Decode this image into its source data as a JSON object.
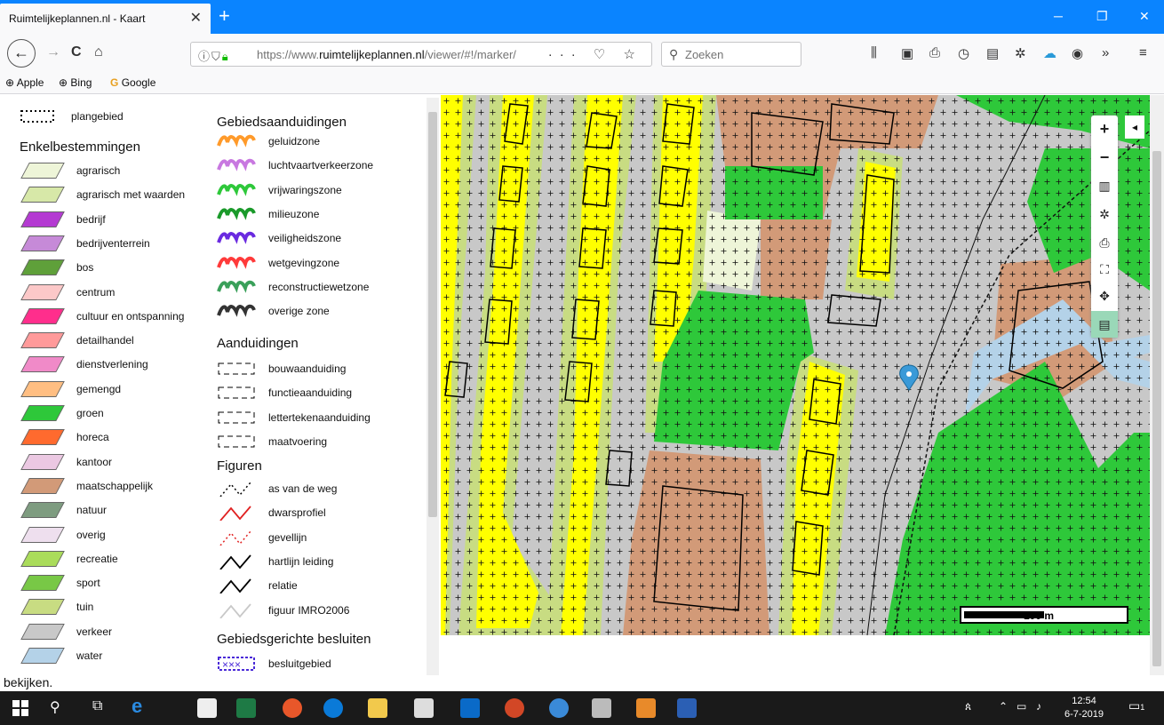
{
  "browser": {
    "tab_title": "Ruimtelijkeplannen.nl - Kaart",
    "tab_close": "✕",
    "new_tab": "+",
    "window_controls": [
      "─",
      "❐",
      "✕"
    ],
    "nav": {
      "back": "←",
      "forward": "→",
      "reload": "C",
      "home": "⌂"
    },
    "url_prefix": "https://www.",
    "url_domain": "ruimtelijkeplannen.nl",
    "url_path": "/viewer/#!/marker/",
    "url_actions": "··· ♡ ☆",
    "search_placeholder": "Zoeken",
    "toolbar_icons": [
      "library-icon",
      "sidebar-icon",
      "print-icon",
      "history-icon",
      "screenshot-icon",
      "extensions-icon",
      "cloud-icon",
      "account-icon",
      "overflow-icon",
      "menu-icon"
    ],
    "toolbar_glyphs": [
      "⫼",
      "▣",
      "⎙",
      "◷",
      "▤",
      "✲",
      "☁",
      "◉",
      "»",
      "≡"
    ],
    "bookmarks": [
      {
        "label": "Apple"
      },
      {
        "label": "Bing"
      },
      {
        "label": "Google"
      }
    ]
  },
  "legend": {
    "plangebied": "plangebied",
    "enkel_title": "Enkelbestemmingen",
    "enkel": [
      {
        "label": "agrarisch",
        "color": "#eef5d8"
      },
      {
        "label": "agrarisch met waarden",
        "color": "#d7e8a8"
      },
      {
        "label": "bedrijf",
        "color": "#b43ad2"
      },
      {
        "label": "bedrijventerrein",
        "color": "#c68ad8"
      },
      {
        "label": "bos",
        "color": "#5fa03a"
      },
      {
        "label": "centrum",
        "color": "#fcc8c8"
      },
      {
        "label": "cultuur en ontspanning",
        "color": "#ff2e8c"
      },
      {
        "label": "detailhandel",
        "color": "#ff9a9a"
      },
      {
        "label": "dienstverlening",
        "color": "#f08ac8"
      },
      {
        "label": "gemengd",
        "color": "#ffbe82"
      },
      {
        "label": "groen",
        "color": "#2ec83a"
      },
      {
        "label": "horeca",
        "color": "#ff6a2e"
      },
      {
        "label": "kantoor",
        "color": "#ebc8e2"
      },
      {
        "label": "maatschappelijk",
        "color": "#d29a78"
      },
      {
        "label": "natuur",
        "color": "#7e9c80"
      },
      {
        "label": "overig",
        "color": "#eedfee"
      },
      {
        "label": "recreatie",
        "color": "#aadc5a"
      },
      {
        "label": "sport",
        "color": "#78c846"
      },
      {
        "label": "tuin",
        "color": "#c8dc82"
      },
      {
        "label": "verkeer",
        "color": "#c8c8c8"
      },
      {
        "label": "water",
        "color": "#b4d2e8"
      }
    ],
    "gebied_title": "Gebiedsaanduidingen",
    "gebied": [
      {
        "label": "geluidzone",
        "color": "#ff9a2a"
      },
      {
        "label": "luchtvaartverkeerzone",
        "color": "#c878e0"
      },
      {
        "label": "vrijwaringszone",
        "color": "#2ec83a"
      },
      {
        "label": "milieuzone",
        "color": "#1a9a2a"
      },
      {
        "label": "veiligheidszone",
        "color": "#6a2ae0"
      },
      {
        "label": "wetgevingzone",
        "color": "#ff3a3a"
      },
      {
        "label": "reconstructiewetzone",
        "color": "#3aa05a"
      },
      {
        "label": "overige zone",
        "color": "#333333"
      }
    ],
    "aand_title": "Aanduidingen",
    "aand": [
      {
        "label": "bouwaanduiding"
      },
      {
        "label": "functieaanduiding"
      },
      {
        "label": "lettertekenaanduiding"
      },
      {
        "label": "maatvoering"
      }
    ],
    "fig_title": "Figuren",
    "fig": [
      {
        "label": "as van de weg",
        "color": "#000000",
        "style": "dotted"
      },
      {
        "label": "dwarsprofiel",
        "color": "#e02020",
        "style": "solid"
      },
      {
        "label": "gevellijn",
        "color": "#e02020",
        "style": "dotted"
      },
      {
        "label": "hartlijn leiding",
        "color": "#000000",
        "style": "solid"
      },
      {
        "label": "relatie",
        "color": "#000000",
        "style": "solid"
      },
      {
        "label": "figuur IMRO2006",
        "color": "#c8c8c8",
        "style": "solid"
      }
    ],
    "besl_title": "Gebiedsgerichte besluiten",
    "besl": [
      {
        "label": "besluitgebied",
        "color": "#4a2ad8"
      }
    ]
  },
  "map": {
    "scale_label": "100 m",
    "tools": [
      "+",
      "−",
      "▥",
      "✲",
      "⎙",
      "⛶",
      "✥",
      "▤"
    ],
    "tool_names": [
      "zoom-in-button",
      "zoom-out-button",
      "measure-button",
      "settings-button",
      "print-button",
      "fullscreen-button",
      "locate-button",
      "layers-button"
    ],
    "collapse": "◂"
  },
  "page": {
    "footer_text": "bekijken."
  },
  "taskbar": {
    "time": "12:54",
    "date": "6-7-2019",
    "notification_count": "1"
  }
}
